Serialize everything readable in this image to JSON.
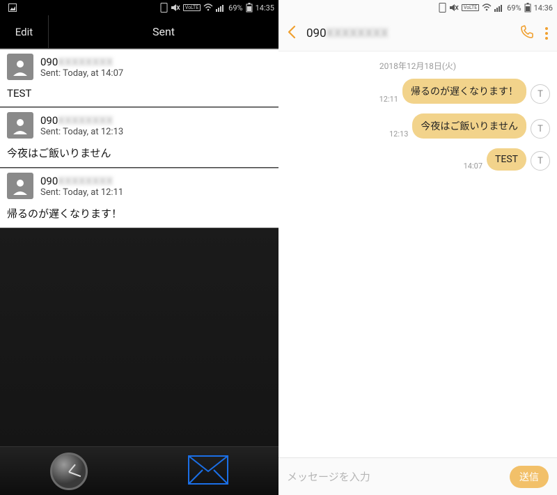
{
  "left": {
    "status": {
      "battery": "69%",
      "time": "14:35"
    },
    "nav": {
      "edit": "Edit",
      "title": "Sent"
    },
    "messages": [
      {
        "number_prefix": "090",
        "number_blur": "XXXXXXXX",
        "sentline": "Sent: Today, at 14:07",
        "body": "TEST"
      },
      {
        "number_prefix": "090",
        "number_blur": "XXXXXXXX",
        "sentline": "Sent: Today, at 12:13",
        "body": "今夜はご飯いりません"
      },
      {
        "number_prefix": "090",
        "number_blur": "XXXXXXXX",
        "sentline": "Sent: Today, at 12:11",
        "body": "帰るのが遅くなります！"
      }
    ]
  },
  "right": {
    "status": {
      "battery": "69%",
      "time": "14:36"
    },
    "header": {
      "number_prefix": "090",
      "number_blur": "XXXXXXXX"
    },
    "date": "2018年12月18日(火)",
    "bubbles": [
      {
        "time": "12:11",
        "text": "帰るのが遅くなります！",
        "avatar": "T"
      },
      {
        "time": "12:13",
        "text": "今夜はご飯いりません",
        "avatar": "T"
      },
      {
        "time": "14:07",
        "text": "TEST",
        "avatar": "T"
      }
    ],
    "compose": {
      "placeholder": "メッセージを入力",
      "send": "送信"
    }
  }
}
